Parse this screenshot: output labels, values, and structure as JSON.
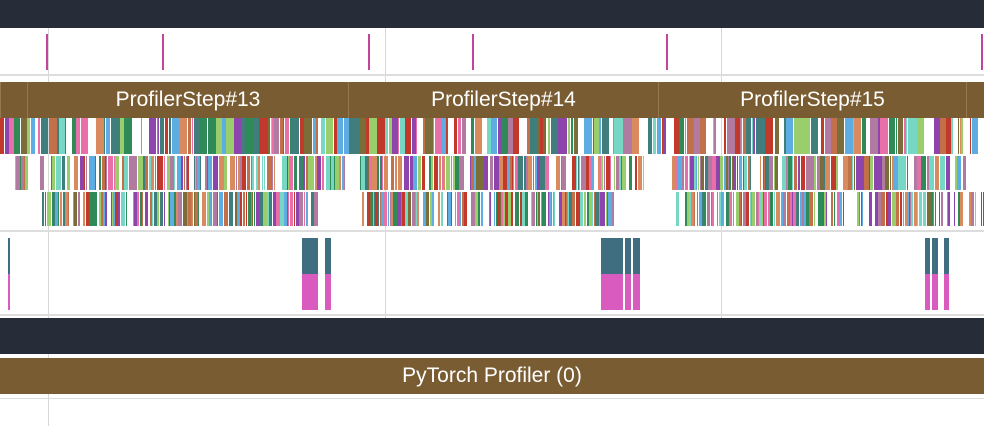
{
  "timeline": {
    "steps": [
      {
        "label": ""
      },
      {
        "label": "ProfilerStep#13"
      },
      {
        "label": "ProfilerStep#14"
      },
      {
        "label": "ProfilerStep#15"
      },
      {
        "label": ""
      }
    ],
    "root_process": {
      "label": "PyTorch Profiler (0)"
    }
  },
  "colors": {
    "header_bar": "#262d39",
    "step_slice": "#7a5c33",
    "marker": "#c2449b",
    "memcpy_top": "#3f6e80",
    "memcpy_bottom": "#d95bbf",
    "palette": [
      "#8e44ad",
      "#c0392b",
      "#76d7c4",
      "#e86fa7",
      "#3f7e7c",
      "#2e8b57",
      "#7b6d3a",
      "#d98a5f",
      "#5dade2",
      "#b07aa1",
      "#c1704a",
      "#9acd6b"
    ]
  }
}
